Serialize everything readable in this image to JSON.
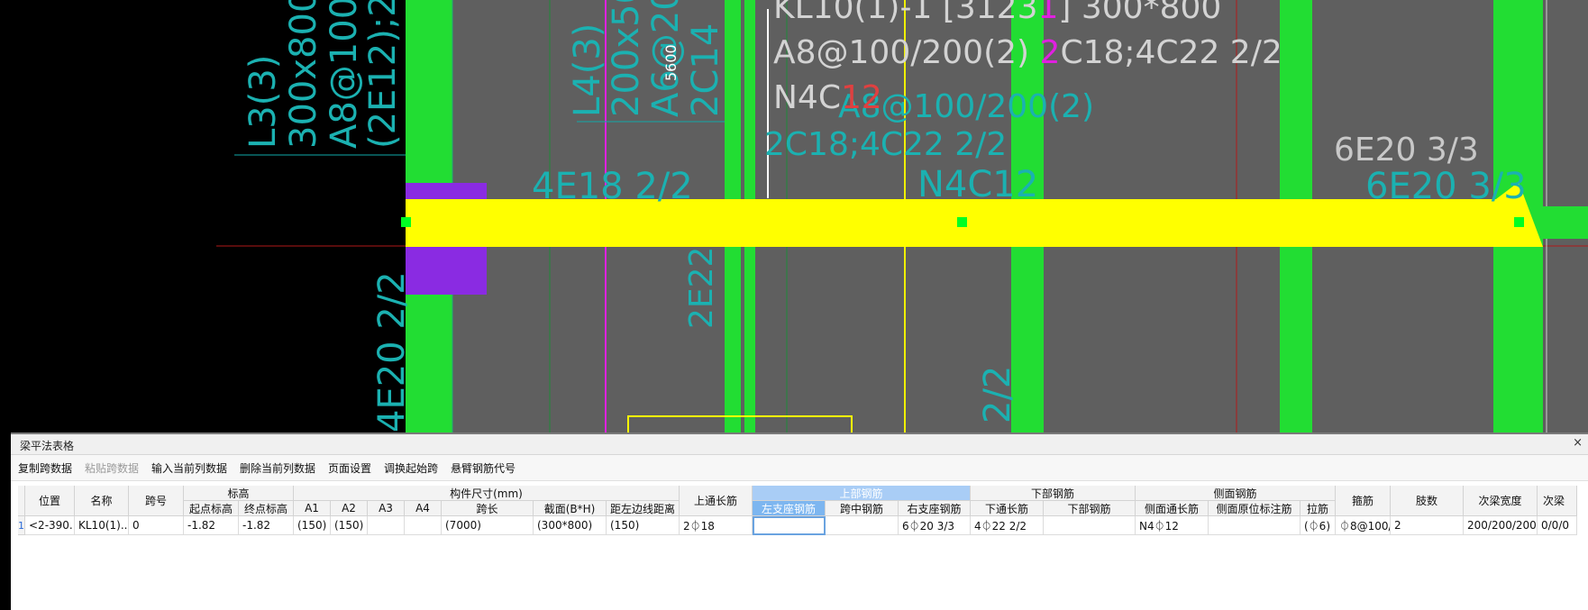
{
  "canvas": {
    "texts": {
      "kl10_line1": "KL10(1)-1 [3123",
      "kl10_line1_mag": "1",
      "kl10_line1_tail": "] 300*800",
      "kl10_line2a": "A8@100/200(2) ",
      "kl10_line2_mag": "2",
      "kl10_line2b": "C18;4C22 2/2",
      "kl10_line3a": "N4C",
      "kl10_line3_red": "12",
      "dim_5600": "5600",
      "right_label": "6E20 3/3",
      "faint_6e20": "6E20 3/3",
      "faint_4e18": "4E18 2/2",
      "faint_n4c12": "N4C12",
      "faint_2c18": "2C18;4C22 2/2",
      "faint_a8": "A8@100/200(2)",
      "faint_2e22": "2E22",
      "faint_22": "2/2",
      "l3_1": "L3(3)",
      "l3_2": "300x800",
      "l3_3": "A8@100/200(2)",
      "l3_4": "(2E12);2E22",
      "l4_1": "L4(3)",
      "l4_2": "200x500",
      "l4_3": "A6@200(2)",
      "l4_4": "2C14",
      "left_bottom": "4E20 2/2"
    }
  },
  "panel": {
    "title": "梁平法表格",
    "close_icon": "×",
    "toolbar": {
      "copy": "复制跨数据",
      "paste": "粘贴跨数据",
      "input_col": "输入当前列数据",
      "delete_col": "删除当前列数据",
      "page_setup": "页面设置",
      "swap_start": "调换起始跨",
      "cantilever": "悬臂钢筋代号"
    },
    "headers": {
      "position": "位置",
      "name": "名称",
      "span_no": "跨号",
      "elevation": "标高",
      "start_elev": "起点标高",
      "end_elev": "终点标高",
      "size": "构件尺寸(mm)",
      "a1": "A1",
      "a2": "A2",
      "a3": "A3",
      "a4": "A4",
      "span_len": "跨长",
      "section": "截面(B*H)",
      "left_edge": "距左边线距离",
      "top_through": "上通长筋",
      "top_rebar": "上部钢筋",
      "left_support": "左支座钢筋",
      "mid_span": "跨中钢筋",
      "right_support": "右支座钢筋",
      "bottom_rebar": "下部钢筋",
      "bottom_through": "下通长筋",
      "bottom_bars": "下部钢筋",
      "side_rebar": "侧面钢筋",
      "side_through": "侧面通长筋",
      "side_in_situ": "侧面原位标注筋",
      "tie": "拉筋",
      "stirrup": "箍筋",
      "legs": "肢数",
      "sec_width": "次梁宽度",
      "sec_beam": "次梁"
    },
    "row": {
      "num": "1",
      "position": "<2-390...",
      "name": "KL10(1)...",
      "span_no": "0",
      "start_elev": "-1.82",
      "end_elev": "-1.82",
      "a1": "(150)",
      "a2": "(150)",
      "a3": "",
      "a4": "",
      "span_len": "(7000)",
      "section": "(300*800)",
      "left_edge": "(150)",
      "top_through": "2⏀18",
      "left_support": "",
      "mid_span": "",
      "right_support": "6⏀20 3/3",
      "bottom_through": "4⏀22 2/2",
      "bottom_bars": "",
      "side_through": "N4⏀12",
      "side_in_situ": "",
      "tie": "(⏀6)",
      "stirrup": "⏀8@100/",
      "legs": "2",
      "sec_width": "200/200/200",
      "sec_beam": "0/0/0"
    }
  }
}
